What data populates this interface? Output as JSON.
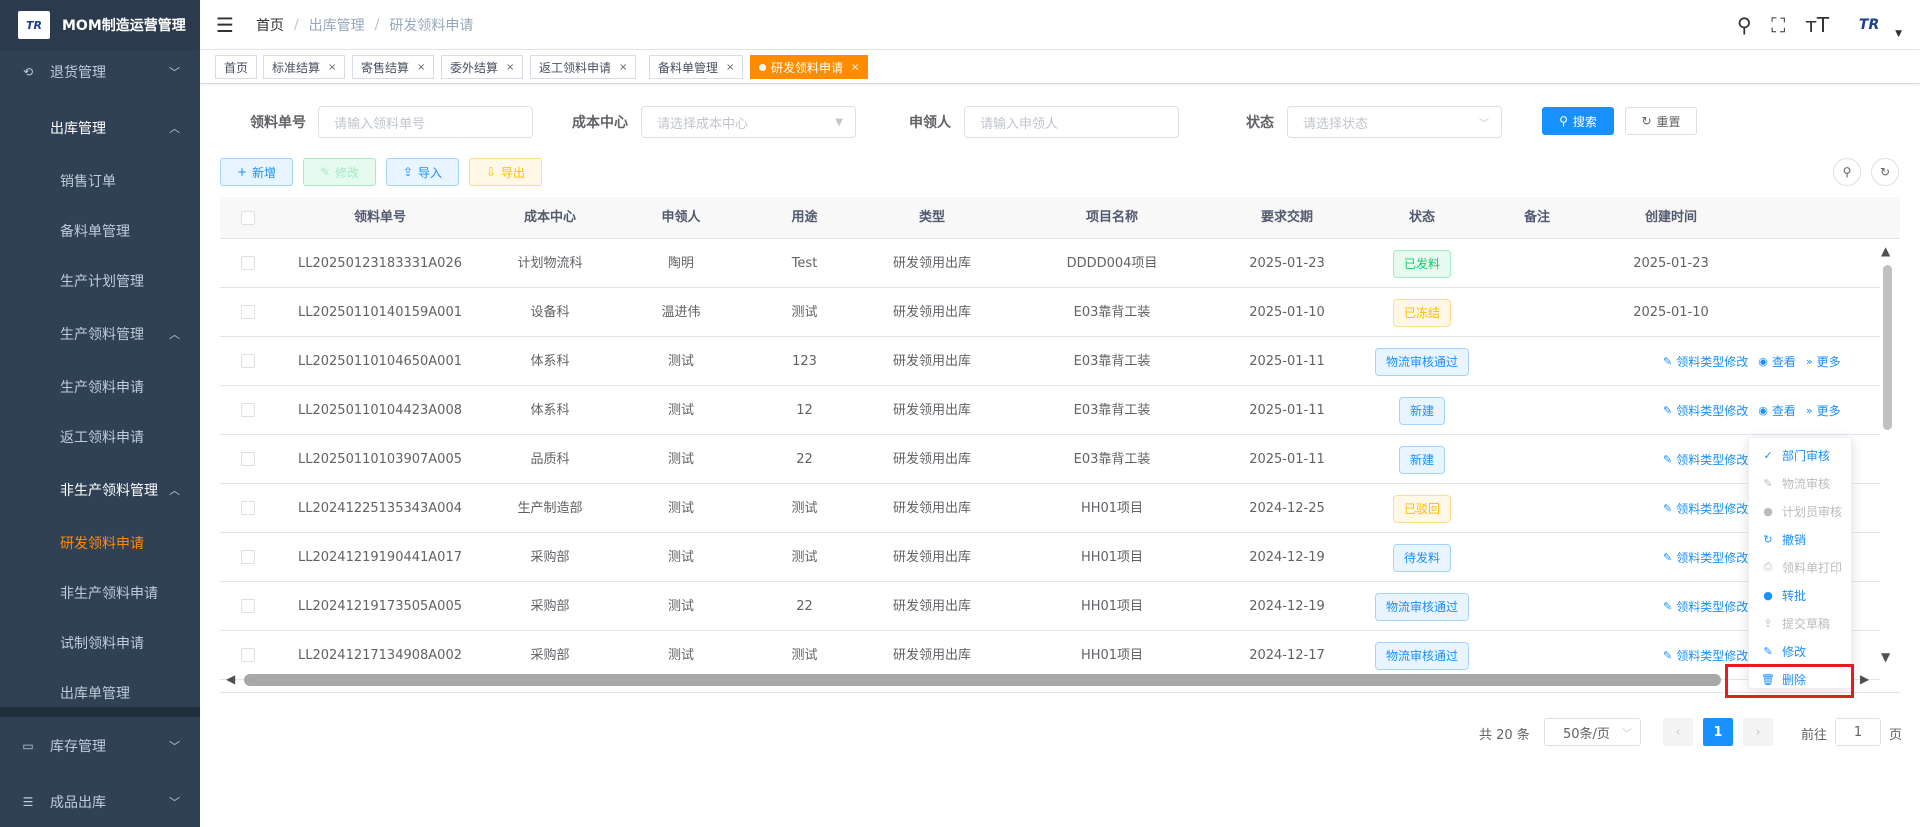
{
  "app": {
    "logo_text": "TR",
    "title": "MOM制造运营管理"
  },
  "sidebar": {
    "items": [
      {
        "label": "退货管理",
        "icon": "return-icon",
        "arrow": "﹀"
      },
      {
        "label": "出库管理",
        "arrow": "︿"
      },
      {
        "label": "销售订单"
      },
      {
        "label": "备料单管理"
      },
      {
        "label": "生产计划管理"
      },
      {
        "label": "生产领料管理",
        "arrow": "︿"
      },
      {
        "label": "生产领料申请"
      },
      {
        "label": "返工领料申请"
      },
      {
        "label": "非生产领料管理",
        "arrow": "︿"
      },
      {
        "label": "研发领料申请"
      },
      {
        "label": "非生产领料申请"
      },
      {
        "label": "试制领料申请"
      },
      {
        "label": "出库单管理"
      },
      {
        "label": "库存管理",
        "icon": "monitor-icon",
        "arrow": "﹀"
      },
      {
        "label": "成品出库",
        "icon": "list-icon",
        "arrow": "﹀"
      }
    ]
  },
  "header": {
    "hamburger_glyph": "☰",
    "breadcrumb": [
      "首页",
      "出库管理",
      "研发领料申请"
    ],
    "separator": "/",
    "icons": {
      "search": "⚲",
      "fullscreen": "⛶",
      "font_size": "ᴛT"
    },
    "avatar_text": "TR"
  },
  "tags": [
    {
      "label": "首页",
      "closable": ""
    },
    {
      "label": "标准结算",
      "closable": "×"
    },
    {
      "label": "寄售结算",
      "closable": "×"
    },
    {
      "label": "委外结算",
      "closable": "×"
    },
    {
      "label": "返工领料申请",
      "closable": "×"
    },
    {
      "label": "备料单管理",
      "closable": "×"
    },
    {
      "label": "研发领料申请",
      "closable": "×"
    }
  ],
  "search": {
    "fields": [
      {
        "label": "领料单号",
        "placeholder": "请输入领料单号"
      },
      {
        "label": "成本中心",
        "placeholder": "请选择成本中心"
      },
      {
        "label": "申领人",
        "placeholder": "请输入申领人"
      },
      {
        "label": "状态",
        "placeholder": "请选择状态"
      }
    ],
    "search_button": "搜索",
    "reset_button": "重置"
  },
  "toolbar": {
    "add": "新增",
    "edit": "修改",
    "import": "导入",
    "export": "导出"
  },
  "table": {
    "columns": [
      "领料单号",
      "成本中心",
      "申领人",
      "用途",
      "类型",
      "项目名称",
      "要求交期",
      "状态",
      "备注",
      "创建时间"
    ],
    "rows": [
      {
        "no": "LL20250123183331A026",
        "center": "计划物流科",
        "applicant": "陶明",
        "usage": "Test",
        "type": "研发领用出库",
        "project": "DDDD004项目",
        "due": "2025-01-23",
        "status": "已发料",
        "status_color": "green",
        "remark": "",
        "created": "2025-01-23"
      },
      {
        "no": "LL20250110140159A001",
        "center": "设备科",
        "applicant": "温进伟",
        "usage": "测试",
        "type": "研发领用出库",
        "project": "E03靠背工装",
        "due": "2025-01-10",
        "status": "已冻结",
        "status_color": "orange",
        "remark": "",
        "created": "2025-01-10"
      },
      {
        "no": "LL20250110104650A001",
        "center": "体系科",
        "applicant": "测试",
        "usage": "123",
        "type": "研发领用出库",
        "project": "E03靠背工装",
        "due": "2025-01-11",
        "status": "物流审核通过",
        "status_color": "blue",
        "remark": "",
        "created": ""
      },
      {
        "no": "LL20250110104423A008",
        "center": "体系科",
        "applicant": "测试",
        "usage": "12",
        "type": "研发领用出库",
        "project": "E03靠背工装",
        "due": "2025-01-11",
        "status": "新建",
        "status_color": "blue",
        "remark": "",
        "created": ""
      },
      {
        "no": "LL20250110103907A005",
        "center": "品质科",
        "applicant": "测试",
        "usage": "22",
        "type": "研发领用出库",
        "project": "E03靠背工装",
        "due": "2025-01-11",
        "status": "新建",
        "status_color": "blue",
        "remark": "",
        "created": ""
      },
      {
        "no": "LL20241225135343A004",
        "center": "生产制造部",
        "applicant": "测试",
        "usage": "测试",
        "type": "研发领用出库",
        "project": "HH01项目",
        "due": "2024-12-25",
        "status": "已驳回",
        "status_color": "orange",
        "remark": "",
        "created": ""
      },
      {
        "no": "LL20241219190441A017",
        "center": "采购部",
        "applicant": "测试",
        "usage": "测试",
        "type": "研发领用出库",
        "project": "HH01项目",
        "due": "2024-12-19",
        "status": "待发料",
        "status_color": "blue",
        "remark": "",
        "created": ""
      },
      {
        "no": "LL20241219173505A005",
        "center": "采购部",
        "applicant": "测试",
        "usage": "22",
        "type": "研发领用出库",
        "project": "HH01项目",
        "due": "2024-12-19",
        "status": "物流审核通过",
        "status_color": "blue",
        "remark": "",
        "created": ""
      },
      {
        "no": "LL20241217134908A002",
        "center": "采购部",
        "applicant": "测试",
        "usage": "测试",
        "type": "研发领用出库",
        "project": "HH01项目",
        "due": "2024-12-17",
        "status": "物流审核通过",
        "status_color": "blue",
        "remark": "",
        "created": ""
      }
    ],
    "ops": {
      "edit_type": "领料类型修改",
      "view": "查看",
      "more": "更多"
    }
  },
  "dropdown": {
    "items": [
      {
        "label": "部门审核",
        "icon": "✓",
        "disabled": false
      },
      {
        "label": "物流审核",
        "icon": "✎",
        "disabled": true
      },
      {
        "label": "计划员审核",
        "icon": "●",
        "disabled": true
      },
      {
        "label": "撤销",
        "icon": "↻",
        "disabled": false
      },
      {
        "label": "领料单打印",
        "icon": "⎙",
        "disabled": true
      },
      {
        "label": "转批",
        "icon": "●",
        "disabled": false
      },
      {
        "label": "提交草稿",
        "icon": "⇪",
        "disabled": true
      },
      {
        "label": "修改",
        "icon": "✎",
        "disabled": false
      },
      {
        "label": "删除",
        "icon": "🗑",
        "disabled": false
      }
    ]
  },
  "pagination": {
    "total": "共 20 条",
    "page_size": "50条/页",
    "current_page": "1",
    "goto_prefix": "前往",
    "goto_value": "1",
    "goto_suffix": "页"
  },
  "colors": {
    "sidebar_bg": "#304156",
    "accent_orange": "#ff8c00",
    "primary_blue": "#1890ff",
    "highlight_red": "#e02020"
  }
}
